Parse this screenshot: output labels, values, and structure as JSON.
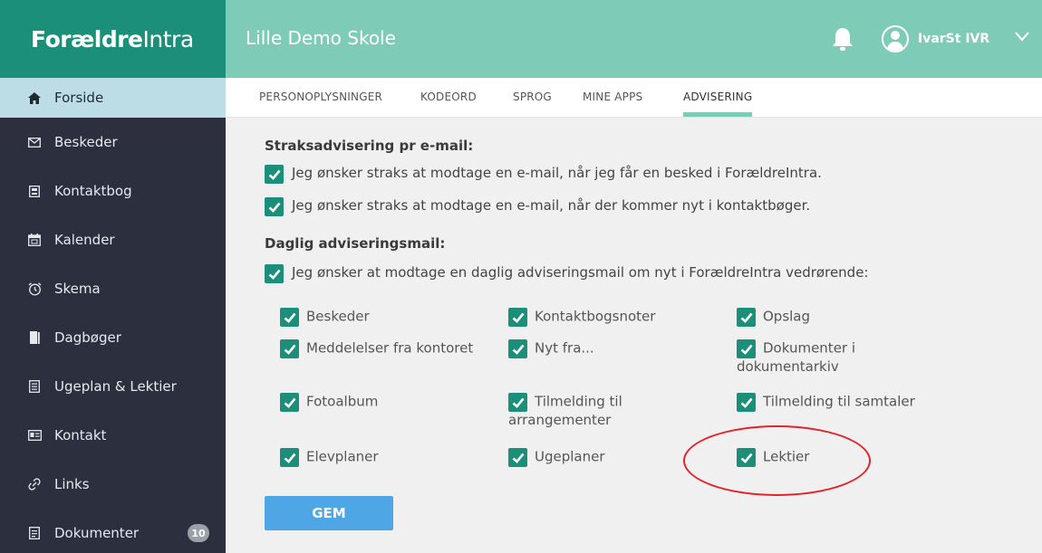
{
  "brand": {
    "bold": "Forældre",
    "light": "Intra"
  },
  "header": {
    "school": "Lille Demo Skole",
    "user_name": "IvarSt IVR"
  },
  "sidebar": {
    "items": [
      {
        "label": "Forside",
        "icon": "home-icon",
        "active": true
      },
      {
        "label": "Beskeder",
        "icon": "envelope-icon"
      },
      {
        "label": "Kontaktbog",
        "icon": "contact-book-icon"
      },
      {
        "label": "Kalender",
        "icon": "calendar-icon"
      },
      {
        "label": "Skema",
        "icon": "alarm-clock-icon"
      },
      {
        "label": "Dagbøger",
        "icon": "book-icon"
      },
      {
        "label": "Ugeplan & Lektier",
        "icon": "document-list-icon"
      },
      {
        "label": "Kontakt",
        "icon": "id-card-icon"
      },
      {
        "label": "Links",
        "icon": "link-icon"
      },
      {
        "label": "Dokumenter",
        "icon": "document-icon",
        "badge": "10"
      }
    ]
  },
  "tabs": [
    {
      "label": "PERSONOPLYSNINGER"
    },
    {
      "label": "KODEORD"
    },
    {
      "label": "SPROG"
    },
    {
      "label": "MINE APPS"
    },
    {
      "label": "ADVISERING",
      "active": true
    }
  ],
  "main": {
    "heading_instant": "Straksadvisering pr e-mail:",
    "instant_options": [
      "Jeg ønsker straks at modtage en e-mail, når jeg får en besked i ForældreIntra.",
      "Jeg ønsker straks at modtage en e-mail, når der kommer nyt i kontaktbøger."
    ],
    "heading_daily": "Daglig adviseringsmail:",
    "daily_master": "Jeg ønsker at modtage en daglig adviseringsmail om nyt i ForældreIntra vedrørende:",
    "daily_options": [
      "Beskeder",
      "Kontaktbogsnoter",
      "Opslag",
      "Meddelelser fra kontoret",
      "Nyt fra...",
      "Dokumenter i dokumentarkiv",
      "Fotoalbum",
      "Tilmelding til arrangementer",
      "Tilmelding til samtaler",
      "Elevplaner",
      "Ugeplaner",
      "Lektier"
    ],
    "save_label": "GEM"
  },
  "colors": {
    "brand": "#1b8f7a",
    "topbar": "#7ecbb7",
    "sidebar": "#2b2f3e",
    "sidebar_active": "#bcdde5",
    "checkbox": "#1b8f7a",
    "save_button": "#4ea7e4",
    "annotation": "#e0242a"
  }
}
